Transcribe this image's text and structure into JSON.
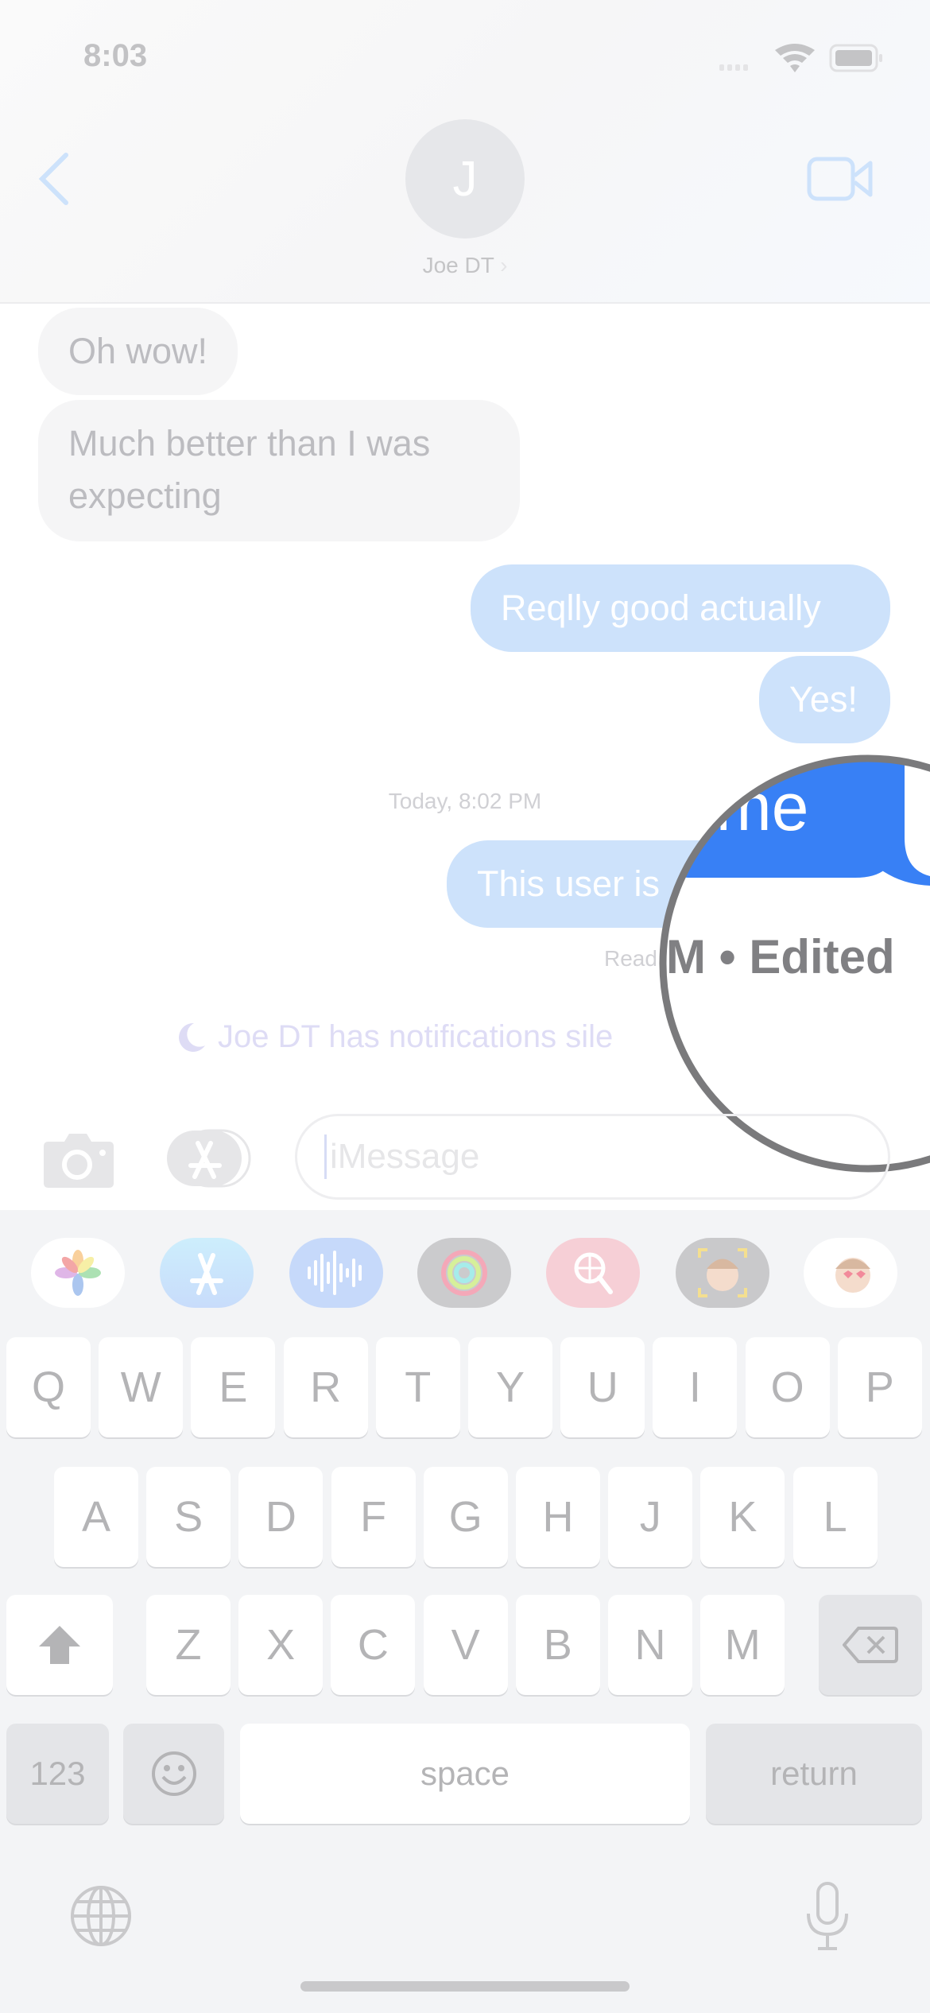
{
  "status_bar": {
    "time": "8:03"
  },
  "header": {
    "avatar_initial": "J",
    "contact_name": "Joe DT",
    "chevron": "›"
  },
  "messages": [
    {
      "type": "incoming",
      "text": "Oh wow!"
    },
    {
      "type": "incoming",
      "text": "Much better than I was expecting"
    },
    {
      "type": "outgoing",
      "text": "Reqlly good actually"
    },
    {
      "type": "outgoing",
      "text": "Yes!"
    },
    {
      "type": "timestamp",
      "text": "Today, 8:02 PM"
    },
    {
      "type": "outgoing",
      "text": "This user is"
    },
    {
      "type": "status",
      "text": "Read"
    },
    {
      "type": "notice",
      "text": "Joe DT has notifications sile"
    }
  ],
  "magnifier": {
    "bubble_text": "ome",
    "status_text": "M • Edited",
    "accent": "#3880f5"
  },
  "input": {
    "placeholder": "iMessage"
  },
  "app_strip": [
    "photos",
    "app-store",
    "audio-message",
    "activity",
    "search-images",
    "memoji-stickers",
    "animoji"
  ],
  "keyboard": {
    "row1": [
      "Q",
      "W",
      "E",
      "R",
      "T",
      "Y",
      "U",
      "I",
      "O",
      "P"
    ],
    "row2": [
      "A",
      "S",
      "D",
      "F",
      "G",
      "H",
      "J",
      "K",
      "L"
    ],
    "row3": [
      "Z",
      "X",
      "C",
      "V",
      "B",
      "N",
      "M"
    ],
    "numbers": "123",
    "space": "space",
    "return": "return"
  }
}
